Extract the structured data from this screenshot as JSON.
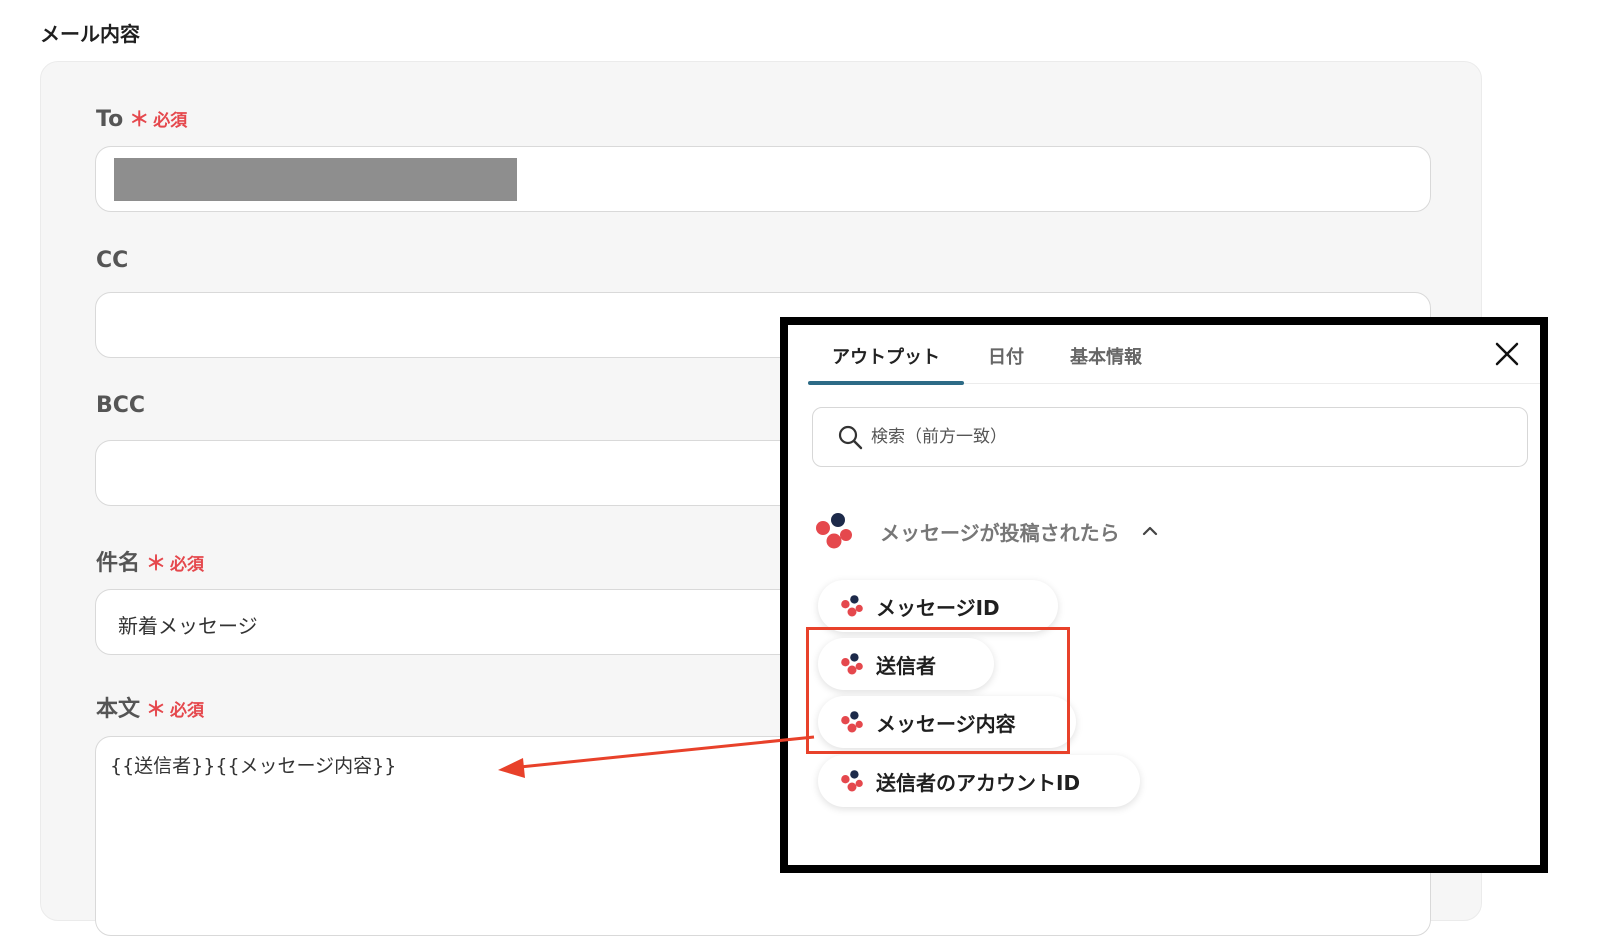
{
  "section_title": "メール内容",
  "required_mark": "＊",
  "required_text": "必須",
  "fields": {
    "to": {
      "label": "To"
    },
    "cc": {
      "label": "CC",
      "value": ""
    },
    "bcc": {
      "label": "BCC",
      "value": ""
    },
    "subject": {
      "label": "件名",
      "value": "新着メッセージ"
    },
    "body": {
      "label": "本文",
      "value": "{{送信者}}{{メッセージ内容}}"
    }
  },
  "popup": {
    "tabs": [
      "アウトプット",
      "日付",
      "基本情報"
    ],
    "active_tab": "アウトプット",
    "search_placeholder": "検索（前方一致）",
    "group_title": "メッセージが投稿されたら",
    "items": [
      "メッセージID",
      "送信者",
      "メッセージ内容",
      "送信者のアカウントID"
    ]
  },
  "colors": {
    "required": "#e5484d",
    "accent_tab": "#2d6b86",
    "highlight": "#e8412a"
  }
}
